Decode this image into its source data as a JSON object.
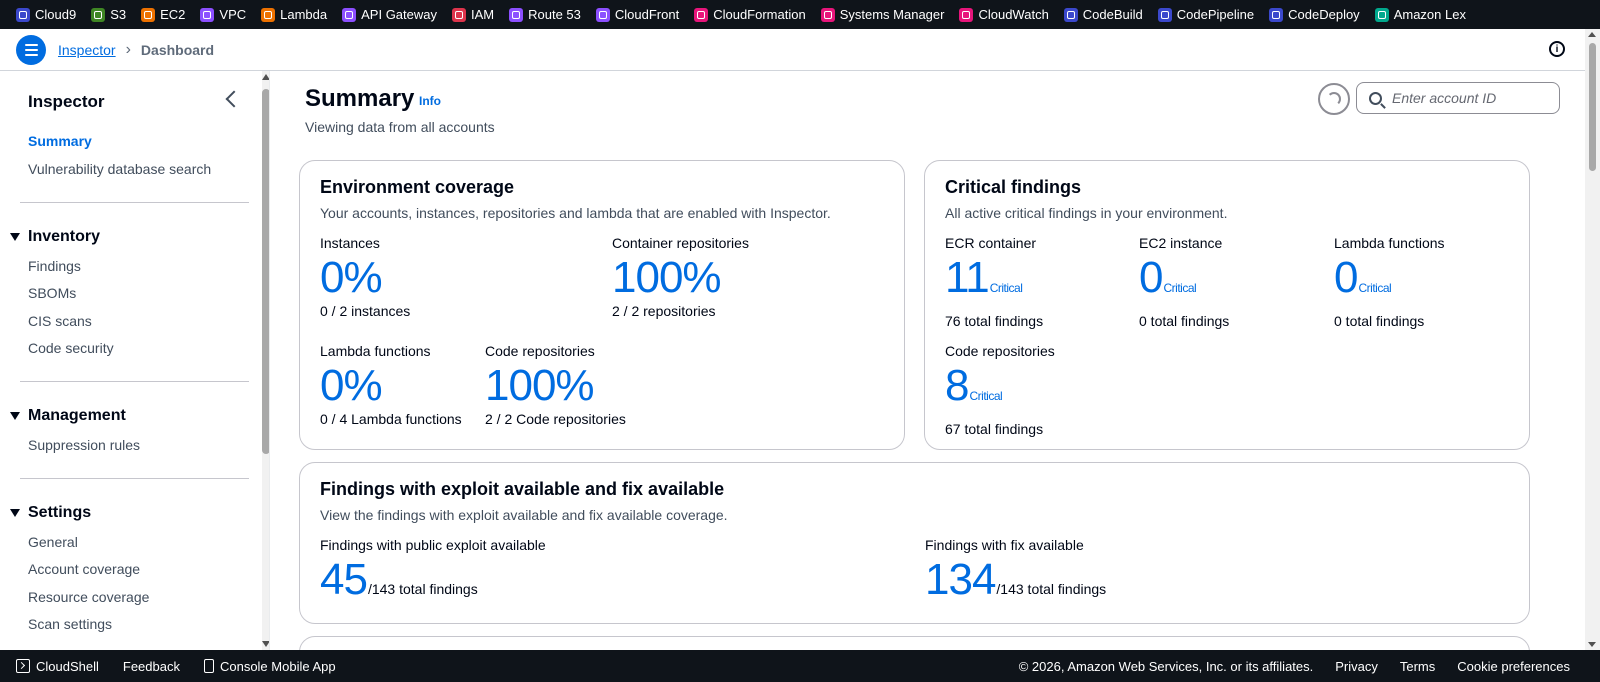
{
  "services": [
    {
      "label": "Cloud9",
      "icon": "cloud9-icon",
      "color": "#3b48cc"
    },
    {
      "label": "S3",
      "icon": "s3-icon",
      "color": "#3f8624"
    },
    {
      "label": "EC2",
      "icon": "ec2-icon",
      "color": "#ed7100"
    },
    {
      "label": "VPC",
      "icon": "vpc-icon",
      "color": "#8c4fff"
    },
    {
      "label": "Lambda",
      "icon": "lambda-icon",
      "color": "#ed7100"
    },
    {
      "label": "API Gateway",
      "icon": "api-gateway-icon",
      "color": "#8c4fff"
    },
    {
      "label": "IAM",
      "icon": "iam-icon",
      "color": "#dd344c"
    },
    {
      "label": "Route 53",
      "icon": "route53-icon",
      "color": "#8c4fff"
    },
    {
      "label": "CloudFront",
      "icon": "cloudfront-icon",
      "color": "#8c4fff"
    },
    {
      "label": "CloudFormation",
      "icon": "cloudformation-icon",
      "color": "#e7157b"
    },
    {
      "label": "Systems Manager",
      "icon": "systems-manager-icon",
      "color": "#e7157b"
    },
    {
      "label": "CloudWatch",
      "icon": "cloudwatch-icon",
      "color": "#e7157b"
    },
    {
      "label": "CodeBuild",
      "icon": "codebuild-icon",
      "color": "#3b48cc"
    },
    {
      "label": "CodePipeline",
      "icon": "codepipeline-icon",
      "color": "#3b48cc"
    },
    {
      "label": "CodeDeploy",
      "icon": "codedeploy-icon",
      "color": "#3b48cc"
    },
    {
      "label": "Amazon Lex",
      "icon": "lex-icon",
      "color": "#01a88d"
    }
  ],
  "breadcrumb": {
    "root": "Inspector",
    "current": "Dashboard"
  },
  "sidebar": {
    "title": "Inspector",
    "top_items": [
      "Summary",
      "Vulnerability database search"
    ],
    "sections": [
      {
        "title": "Inventory",
        "items": [
          "Findings",
          "SBOMs",
          "CIS scans",
          "Code security"
        ]
      },
      {
        "title": "Management",
        "items": [
          "Suppression rules"
        ]
      },
      {
        "title": "Settings",
        "items": [
          "General",
          "Account coverage",
          "Resource coverage",
          "Scan settings"
        ]
      }
    ]
  },
  "summary": {
    "title": "Summary",
    "info": "Info",
    "subtitle": "Viewing data from all accounts",
    "search_placeholder": "Enter account ID"
  },
  "coverage": {
    "title": "Environment coverage",
    "description": "Your accounts, instances, repositories and lambda that are enabled with Inspector.",
    "metrics": [
      {
        "label": "Instances",
        "value": "0%",
        "sub": "0 / 2 instances"
      },
      {
        "label": "Container repositories",
        "value": "100%",
        "sub": "2 / 2 repositories"
      },
      {
        "label": "Lambda functions",
        "value": "0%",
        "sub": "0 / 4 Lambda functions"
      },
      {
        "label": "Code repositories",
        "value": "100%",
        "sub": "2 / 2 Code repositories"
      }
    ]
  },
  "critical": {
    "title": "Critical findings",
    "description": "All active critical findings in your environment.",
    "critical_label": "Critical",
    "metrics": [
      {
        "label": "ECR container",
        "value": "11",
        "sub": "76 total findings"
      },
      {
        "label": "EC2 instance",
        "value": "0",
        "sub": "0 total findings"
      },
      {
        "label": "Lambda functions",
        "value": "0",
        "sub": "0 total findings"
      },
      {
        "label": "Code repositories",
        "value": "8",
        "sub": "67 total findings"
      }
    ]
  },
  "exploit": {
    "title": "Findings with exploit available and fix available",
    "description": "View the findings with exploit available and fix available coverage.",
    "metrics": [
      {
        "label": "Findings with public exploit available",
        "value": "45",
        "total": "/143 total findings"
      },
      {
        "label": "Findings with fix available",
        "value": "134",
        "total": "/143 total findings"
      }
    ]
  },
  "footer": {
    "cloudshell": "CloudShell",
    "feedback": "Feedback",
    "mobile_app": "Console Mobile App",
    "copyright": "© 2026, Amazon Web Services, Inc. or its affiliates.",
    "privacy": "Privacy",
    "terms": "Terms",
    "cookies": "Cookie preferences"
  }
}
